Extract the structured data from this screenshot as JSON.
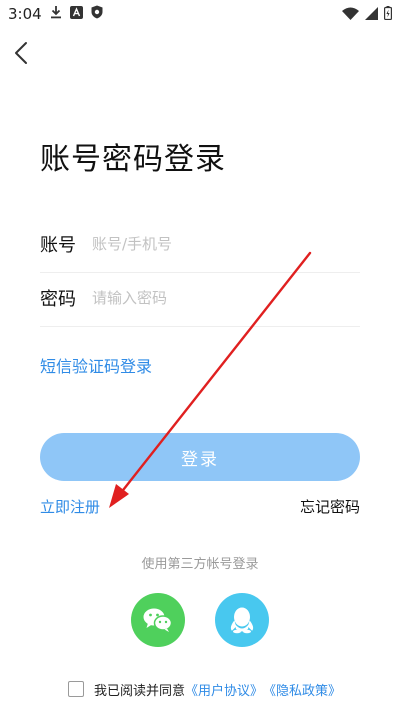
{
  "status_bar": {
    "time": "3:04",
    "left_icons": [
      "download-icon",
      "a-badge-icon",
      "shield-icon"
    ],
    "right_icons": [
      "wifi-icon",
      "signal-icon",
      "battery-icon"
    ]
  },
  "title": "账号密码登录",
  "account": {
    "label": "账号",
    "placeholder": "账号/手机号",
    "value": ""
  },
  "password": {
    "label": "密码",
    "placeholder": "请输入密码",
    "value": ""
  },
  "sms_login": "短信验证码登录",
  "login_button": "登录",
  "register": "立即注册",
  "forgot_password": "忘记密码",
  "third_party_label": "使用第三方帐号登录",
  "third_party": [
    "wechat-icon",
    "qq-icon"
  ],
  "agreement": {
    "prefix": "我已阅读并同意",
    "user_agreement": "《用户协议》",
    "privacy_policy": "《隐私政策》",
    "checked": false
  },
  "colors": {
    "accent": "#2f8be6",
    "login_button": "#8fc6f7",
    "wechat": "#4fd05c",
    "qq": "#48c8ef",
    "annotation_arrow": "#e02020"
  }
}
